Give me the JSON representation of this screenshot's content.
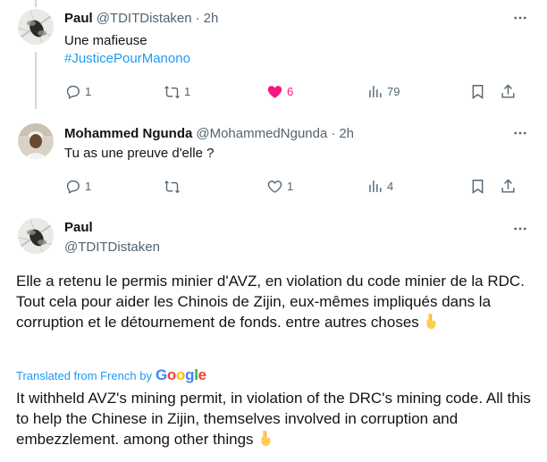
{
  "tweets": [
    {
      "name": "Paul",
      "handle": "@TDITDistaken",
      "separator": "·",
      "time": "2h",
      "text": "Une mafieuse",
      "hashtag": "#JusticePourManono",
      "actions": {
        "reply": "1",
        "retweet": "1",
        "like": "6",
        "views": "79"
      }
    },
    {
      "name": "Mohammed Ngunda",
      "handle": "@MohammedNgunda",
      "separator": "·",
      "time": "2h",
      "text": "Tu as une preuve d'elle ?",
      "actions": {
        "reply": "1",
        "retweet": "",
        "like": "1",
        "views": "4"
      }
    }
  ],
  "main": {
    "name": "Paul",
    "handle": "@TDITDistaken",
    "text": "Elle a retenu le permis minier d'AVZ, en violation du code minier de la RDC. Tout cela pour aider les Chinois de Zijin, eux-mêmes impliqués dans la corruption et le détournement de fonds. entre autres choses",
    "translated_label": "Translated from French by",
    "translator": "Google",
    "translation": "It withheld AVZ's mining permit, in violation of the DRC's mining code. All this to help the Chinese in Zijin, themselves involved in corruption and embezzlement. among other things"
  },
  "colors": {
    "accent": "#1d9bf0",
    "like": "#f91880",
    "muted": "#536471",
    "text": "#0f1419"
  },
  "icons": [
    "reply-icon",
    "retweet-icon",
    "heart-icon",
    "views-icon",
    "bookmark-icon",
    "share-icon",
    "more-icon",
    "pointing-down-emoji"
  ]
}
